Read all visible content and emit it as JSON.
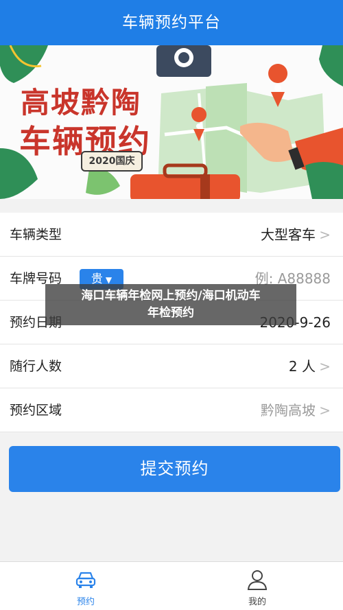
{
  "header": {
    "title": "车辆预约平台"
  },
  "banner": {
    "title_line1": "高坡黔陶",
    "title_line2": "车辆预约",
    "badge": "2020国庆"
  },
  "form": {
    "rows": [
      {
        "label": "车辆类型",
        "value": "大型客车",
        "chevron": ">"
      },
      {
        "label": "车牌号码",
        "province": "贵",
        "province_arrow": "▼",
        "placeholder": "例: A88888"
      },
      {
        "label": "预约日期",
        "value": "2020-9-26"
      },
      {
        "label": "随行人数",
        "value": "2 人",
        "chevron": ">"
      },
      {
        "label": "预约区域",
        "placeholder": "黔陶高坡",
        "chevron": ">"
      }
    ]
  },
  "submit_label": "提交预约",
  "overlay": {
    "line1": "海口车辆年检网上预约/海口机动车",
    "line2": "年检预约"
  },
  "tabbar": {
    "tabs": [
      {
        "label": "预约",
        "icon": "car-icon",
        "active": true,
        "color": "#2a83ea"
      },
      {
        "label": "我的",
        "icon": "user-icon",
        "active": false
      }
    ]
  },
  "colors": {
    "primary": "#2a83ea",
    "header": "#1f7ee6",
    "banner_title": "#c9352b"
  }
}
